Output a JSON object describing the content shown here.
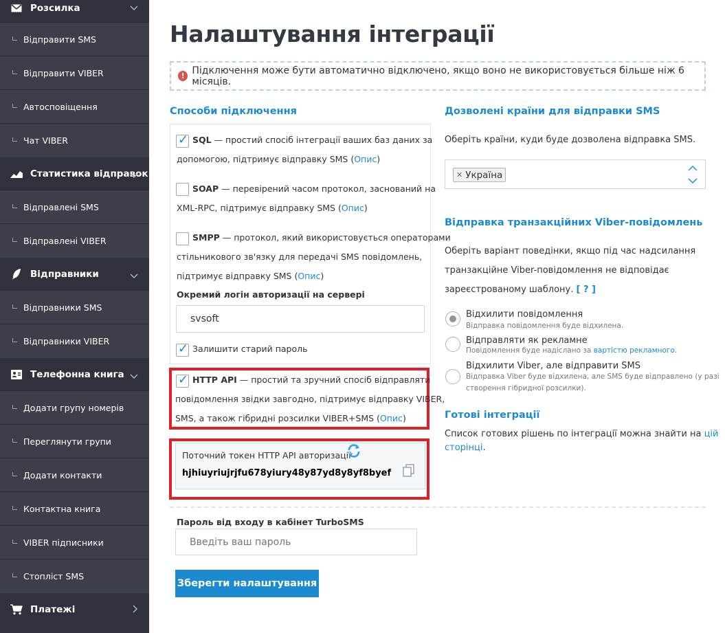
{
  "sidebar": {
    "sections": [
      {
        "label": "Розсилка",
        "items": [
          "Відправити SMS",
          "Відправити VIBER",
          "Автосповіщення",
          "Чат VIBER"
        ]
      },
      {
        "label": "Статистика відправок",
        "items": [
          "Відправлені SMS",
          "Відправлені VIBER"
        ]
      },
      {
        "label": "Відправники",
        "items": [
          "Відправники SMS",
          "Відправники VIBER"
        ]
      },
      {
        "label": "Телефонна книга",
        "items": [
          "Додати групу номерів",
          "Переглянути групи",
          "Додати контакти",
          "Контактна книга",
          "VIBER підписники",
          "Стопліст SMS"
        ]
      },
      {
        "label": "Платежі",
        "items": []
      }
    ]
  },
  "page": {
    "title": "Налаштування інтеграції",
    "notice": "Підключення може бути автоматично відключено, якщо воно не використовується більше ніж 6 місяців."
  },
  "methods": {
    "heading": "Способи підключення",
    "sql": {
      "name": "SQL",
      "line1": " — простий спосіб інтеграції ваших баз даних за",
      "line2": "допомогою, підтримує відправку SMS (",
      "link": "Опис",
      "tail": ")",
      "checked": true
    },
    "soap": {
      "name": "SOAP",
      "line1": " — перевірений часом протокол, заснований на",
      "line2": "XML-RPC, підтримує відправку SMS (",
      "link": "Опис",
      "tail": ")",
      "checked": false
    },
    "smpp": {
      "name": "SMPP",
      "line1": " — протокол, який використовується операторами",
      "line2": "стільникового зв'язку для передачі SMS повідомлень,",
      "line3": "підтримує відправку SMS (",
      "link": "Опис",
      "tail": ")",
      "checked": false
    },
    "login_label": "Окремий логін авторизації на сервері",
    "login_value": "svsoft",
    "keep_password_label": "Залишити старий пароль",
    "keep_password_checked": true,
    "http": {
      "name": "HTTP API",
      "line1": " — простий та зручний спосіб відправляти",
      "line2": "повідомлення звідки завгодно, підтримує відправку VIBER,",
      "line3": "SMS, а також гібридні розсилки VIBER+SMS (",
      "link": "Опис",
      "tail": ")",
      "checked": true
    },
    "token_label": "Поточний токен HTTP API авторизації",
    "token_value": "hjhiuyriujrjfu678yiury48y87yd8y8yf8byef"
  },
  "password": {
    "label": "Пароль від входу в кабінет TurboSMS",
    "placeholder": "Введіть ваш пароль"
  },
  "save_button": "Зберегти налаштування",
  "countries": {
    "heading": "Дозволені країни для відправки SMS",
    "description": "Оберіть країни, куди буде дозволена відправка SMS.",
    "selected": "Україна"
  },
  "viber": {
    "heading": "Відправка транзакційних Viber-повідомлень",
    "line1": "Оберіть варіант поведінки, якщо під час надсилання",
    "line2": "транзакційне Viber-повідомлення не відповідає",
    "line3": "зареєстрованому шаблону.",
    "help": "[ ? ]",
    "options": [
      {
        "title": "Відхилити повідомлення",
        "sub1": "Відправка повідомлення буде відхилена.",
        "selected": true
      },
      {
        "title": "Відправляти як рекламне",
        "sub1": "Повідомлення буде надіслано за ",
        "sub_link": "вартістю рекламного",
        "sub_tail": ".",
        "selected": false
      },
      {
        "title": "Відхилити Viber, але відправити SMS",
        "sub1": "Відправка Viber буде відхилена, але SMS буде відправлено (у разі",
        "sub2": "створення гібридної розсилки).",
        "selected": false
      }
    ]
  },
  "ready": {
    "heading": "Готові інтеграції",
    "line1": "Список готових рішень по інтеграції можна знайти на ",
    "link1": "цій",
    "link2": "сторінці",
    "tail": "."
  },
  "colors": {
    "accent": "#1b8ad0",
    "sidebar": "#2f323a",
    "highlight": "#e11d2a"
  }
}
